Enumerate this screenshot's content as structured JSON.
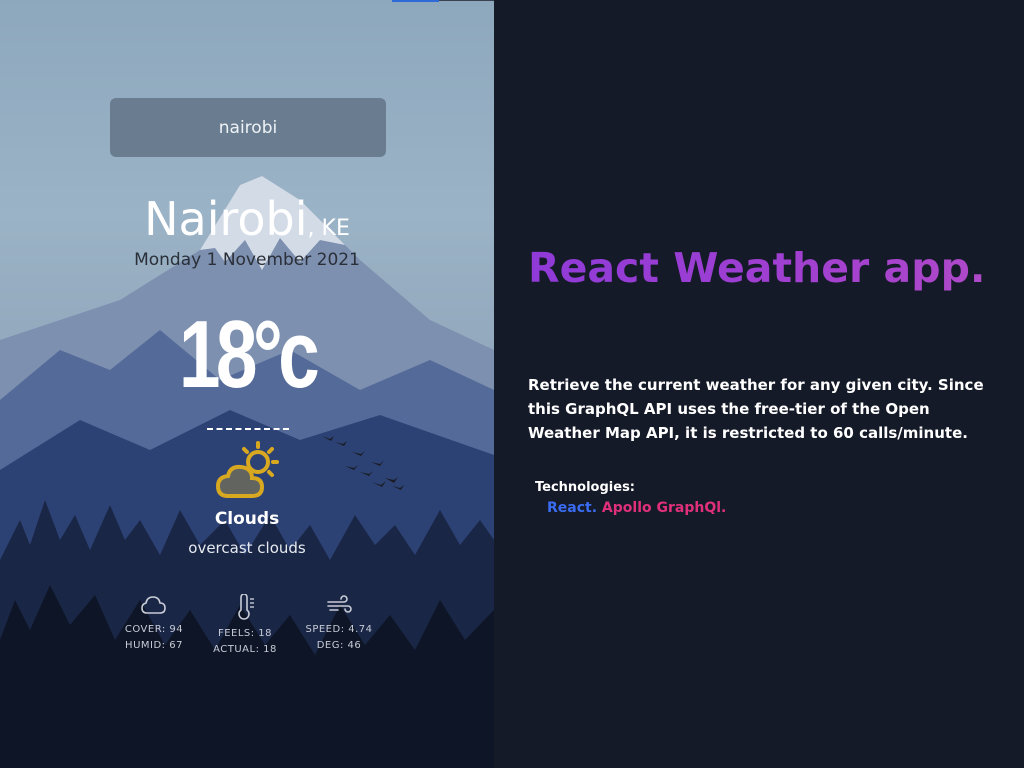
{
  "weather": {
    "search_value": "nairobi",
    "city": "Nairobi",
    "country": ", KE",
    "date": "Monday 1 November 2021",
    "temperature": "18°c",
    "condition": "Clouds",
    "description": "overcast clouds",
    "icon": "partly-cloudy-icon",
    "stats": {
      "cover": "COVER: 94",
      "humid": "HUMID: 67",
      "feels": "FEELS: 18",
      "actual": "ACTUAL: 18",
      "speed": "SPEED: 4.74",
      "deg": "DEG: 46"
    }
  },
  "info": {
    "headline": "React Weather app.",
    "description": "Retrieve the current weather for any given city. Since this GraphQL API uses the free-tier of the Open Weather Map API, it is restricted to 60 calls/minute.",
    "technologies_label": "Technologies:",
    "technologies": [
      "React.",
      "Apollo GraphQl."
    ]
  },
  "colors": {
    "headline_gradient": [
      "#8f3ad8",
      "#b04ac8"
    ],
    "react": "#3a6cf2",
    "apollo": "#e0307c",
    "icon": "#d8a820",
    "background_right": "#151a28"
  }
}
